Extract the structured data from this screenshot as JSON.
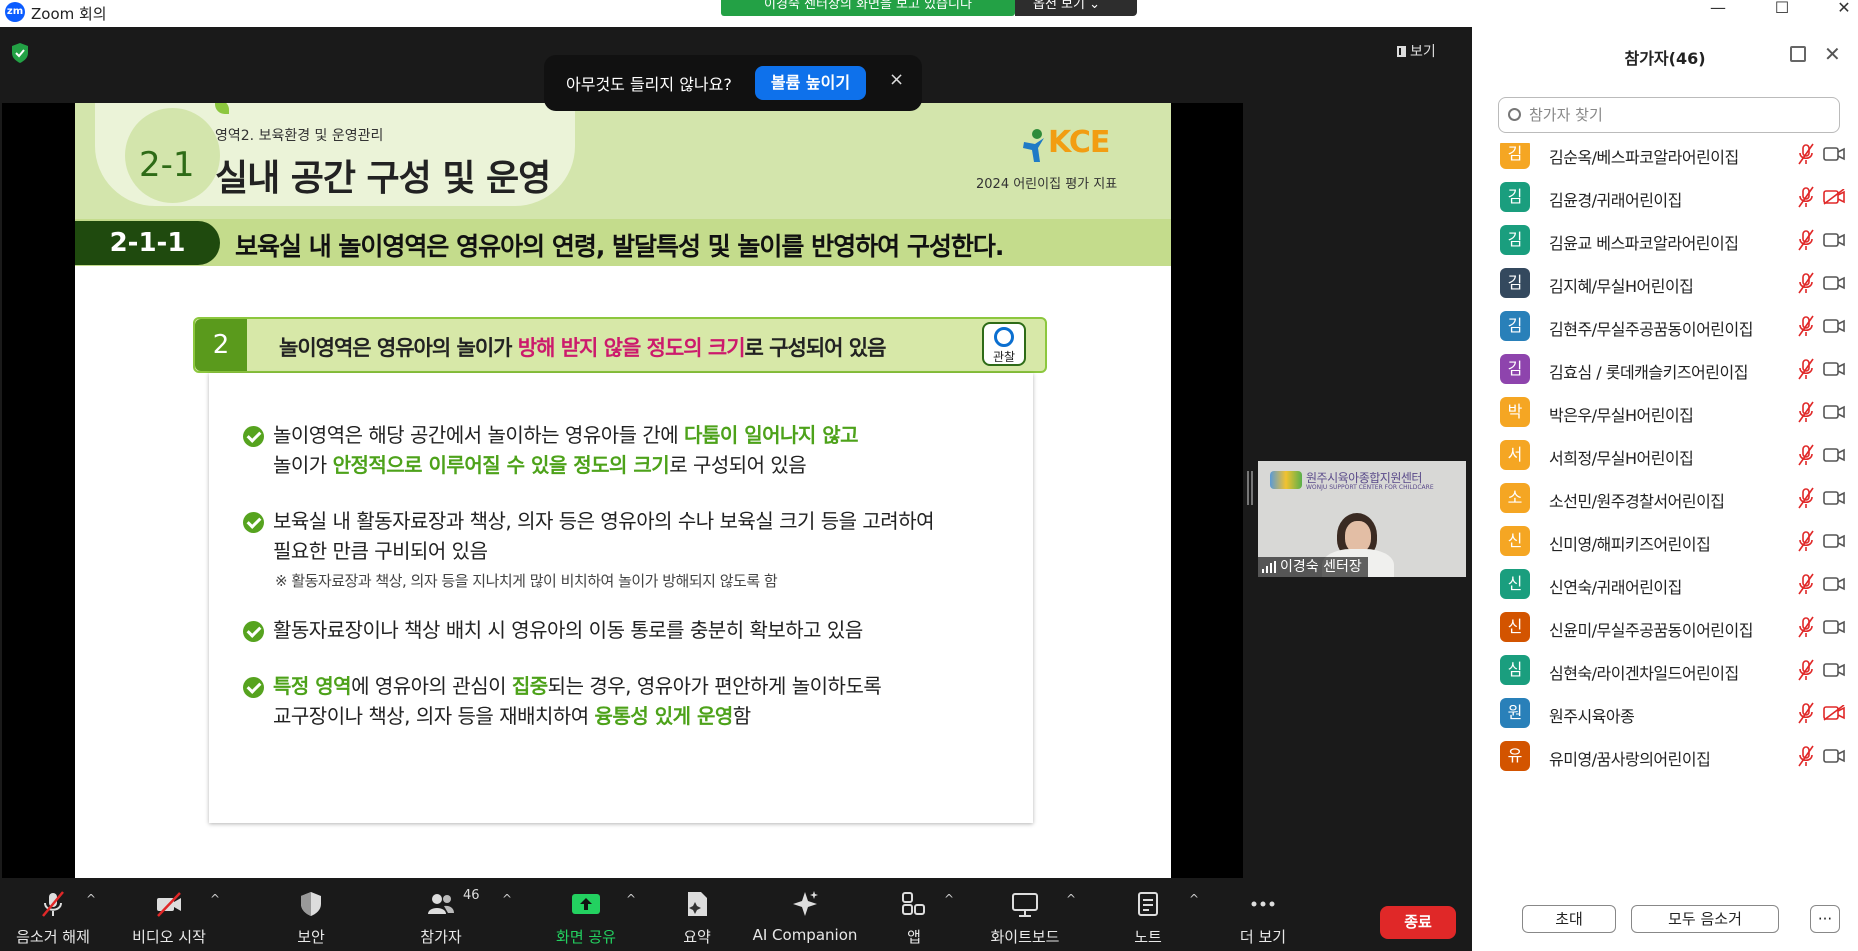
{
  "window": {
    "title": "Zoom 회의",
    "logo_text": "zm"
  },
  "share_banner": {
    "text": "이경숙 센터장의 화면을 보고 있습니다",
    "view_options": "옵션 보기"
  },
  "view_button": "보기",
  "hearing_prompt": {
    "question": "아무것도 들리지 않나요?",
    "button": "볼륨 높이기",
    "close": "×"
  },
  "slide": {
    "area_label": "영역2. 보육환경 및 운영관리",
    "title_number": "2-1",
    "title": "실내 공간 구성 및 운영",
    "kce_logo": "KCE",
    "kce_subtitle": "2024 어린이집 평가 지표",
    "index_code": "2-1-1",
    "index_text": "보육실 내 놀이영역은 영유아의 연령, 발달특성 및 놀이를 반영하여 구성한다.",
    "criterion": {
      "number": "2",
      "text_before": "놀이영역은 영유아의  놀이가 ",
      "text_highlight": "방해 받지 않을 정도의 크기",
      "text_after": "로 구성되어 있음",
      "observe_label": "관찰"
    },
    "items": [
      {
        "l1_a": "놀이영역은 해당 공간에서 놀이하는 영유아들 간에 ",
        "l1_g": "다툼이 일어나지 않고",
        "l2_a": "놀이가 ",
        "l2_g": "안정적으로 이루어질 수 있을 정도의 크기",
        "l2_b": "로 구성되어 있음"
      },
      {
        "l1": "보육실 내 활동자료장과 책상, 의자 등은 영유아의 수나 보육실 크기 등을 고려하여",
        "l2": "필요한 만큼 구비되어 있음",
        "note": "※  활동자료장과 책상, 의자 등을 지나치게 많이 비치하여 놀이가 방해되지 않도록 함"
      },
      {
        "l1": "활동자료장이나 책상 배치 시 영유아의 이동 통로를 충분히 확보하고 있음"
      },
      {
        "l1_g1": "특정 영역",
        "l1_a": "에 영유아의 관심이 ",
        "l1_g2": "집중",
        "l1_b": "되는 경우, 영유아가 편안하게 놀이하도록",
        "l2_a": "교구장이나 책상, 의자 등을 재배치하여 ",
        "l2_g": "융통성 있게 운영",
        "l2_b": "함"
      }
    ]
  },
  "video": {
    "name": "이경숙 센터장",
    "logo_text": "원주시육아종합지원센터",
    "logo_sub": "WONJU SUPPORT CENTER FOR CHILDCARE"
  },
  "toolbar": {
    "mute": "음소거 해제",
    "video": "비디오 시작",
    "security": "보안",
    "participants": "참가자",
    "participants_count": "46",
    "share": "화면 공유",
    "summary": "요약",
    "ai": "AI Companion",
    "apps": "앱",
    "whiteboard": "화이트보드",
    "notes": "노트",
    "more": "더 보기",
    "end": "종료"
  },
  "panel": {
    "title": "참가자(46)",
    "search_placeholder": "참가자 찾기",
    "participants": [
      {
        "initial": "김",
        "name": "김순옥/베스파코알라어린이집",
        "color": "#f5a623",
        "cam_off": false
      },
      {
        "initial": "김",
        "name": "김윤경/귀래어린이집",
        "color": "#1a9e7e",
        "cam_off": true
      },
      {
        "initial": "김",
        "name": "김윤교 베스파코알라어린이집",
        "color": "#1a9e7e",
        "cam_off": false
      },
      {
        "initial": "김",
        "name": "김지혜/무실H어린이집",
        "color": "#34495e",
        "cam_off": false
      },
      {
        "initial": "김",
        "name": "김현주/무실주공꿈동이어린이집",
        "color": "#2980b9",
        "cam_off": false
      },
      {
        "initial": "김",
        "name": "김효심 / 롯데캐슬키즈어린이집",
        "color": "#8e44ad",
        "cam_off": false
      },
      {
        "initial": "박",
        "name": "박은우/무실H어린이집",
        "color": "#f5a623",
        "cam_off": false
      },
      {
        "initial": "서",
        "name": "서희정/무실H어린이집",
        "color": "#f5a623",
        "cam_off": false
      },
      {
        "initial": "소",
        "name": "소선민/원주경찰서어린이집",
        "color": "#f5a623",
        "cam_off": false
      },
      {
        "initial": "신",
        "name": "신미영/해피키즈어린이집",
        "color": "#f5a623",
        "cam_off": false
      },
      {
        "initial": "신",
        "name": "신연숙/귀래어린이집",
        "color": "#1a9e7e",
        "cam_off": false
      },
      {
        "initial": "신",
        "name": "신윤미/무실주공꿈동이어린이집",
        "color": "#d35400",
        "cam_off": false
      },
      {
        "initial": "심",
        "name": "심현숙/라이겐차일드어린이집",
        "color": "#1a9e7e",
        "cam_off": false
      },
      {
        "initial": "원",
        "name": "원주시육아종",
        "color": "#2980b9",
        "cam_off": true
      },
      {
        "initial": "유",
        "name": "유미영/꿈사랑의어린이집",
        "color": "#d35400",
        "cam_off": false
      }
    ],
    "invite": "초대",
    "mute_all": "모두 음소거",
    "more": "···"
  }
}
